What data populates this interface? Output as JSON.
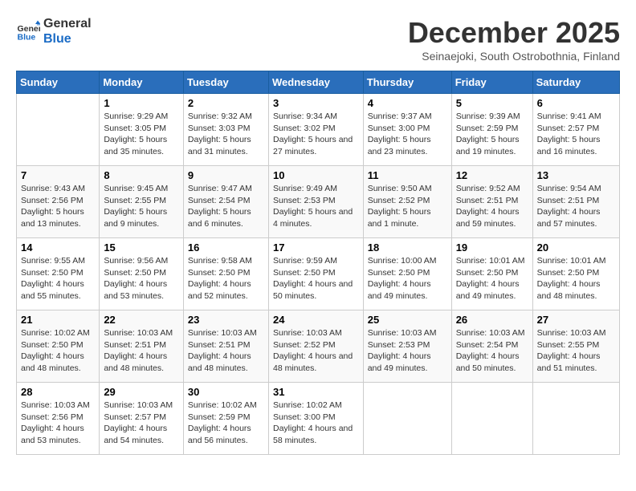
{
  "header": {
    "logo_line1": "General",
    "logo_line2": "Blue",
    "month": "December 2025",
    "location": "Seinaejoki, South Ostrobothnia, Finland"
  },
  "days_of_week": [
    "Sunday",
    "Monday",
    "Tuesday",
    "Wednesday",
    "Thursday",
    "Friday",
    "Saturday"
  ],
  "weeks": [
    [
      {
        "day": "",
        "sunrise": "",
        "sunset": "",
        "daylight": ""
      },
      {
        "day": "1",
        "sunrise": "Sunrise: 9:29 AM",
        "sunset": "Sunset: 3:05 PM",
        "daylight": "Daylight: 5 hours and 35 minutes."
      },
      {
        "day": "2",
        "sunrise": "Sunrise: 9:32 AM",
        "sunset": "Sunset: 3:03 PM",
        "daylight": "Daylight: 5 hours and 31 minutes."
      },
      {
        "day": "3",
        "sunrise": "Sunrise: 9:34 AM",
        "sunset": "Sunset: 3:02 PM",
        "daylight": "Daylight: 5 hours and 27 minutes."
      },
      {
        "day": "4",
        "sunrise": "Sunrise: 9:37 AM",
        "sunset": "Sunset: 3:00 PM",
        "daylight": "Daylight: 5 hours and 23 minutes."
      },
      {
        "day": "5",
        "sunrise": "Sunrise: 9:39 AM",
        "sunset": "Sunset: 2:59 PM",
        "daylight": "Daylight: 5 hours and 19 minutes."
      },
      {
        "day": "6",
        "sunrise": "Sunrise: 9:41 AM",
        "sunset": "Sunset: 2:57 PM",
        "daylight": "Daylight: 5 hours and 16 minutes."
      }
    ],
    [
      {
        "day": "7",
        "sunrise": "Sunrise: 9:43 AM",
        "sunset": "Sunset: 2:56 PM",
        "daylight": "Daylight: 5 hours and 13 minutes."
      },
      {
        "day": "8",
        "sunrise": "Sunrise: 9:45 AM",
        "sunset": "Sunset: 2:55 PM",
        "daylight": "Daylight: 5 hours and 9 minutes."
      },
      {
        "day": "9",
        "sunrise": "Sunrise: 9:47 AM",
        "sunset": "Sunset: 2:54 PM",
        "daylight": "Daylight: 5 hours and 6 minutes."
      },
      {
        "day": "10",
        "sunrise": "Sunrise: 9:49 AM",
        "sunset": "Sunset: 2:53 PM",
        "daylight": "Daylight: 5 hours and 4 minutes."
      },
      {
        "day": "11",
        "sunrise": "Sunrise: 9:50 AM",
        "sunset": "Sunset: 2:52 PM",
        "daylight": "Daylight: 5 hours and 1 minute."
      },
      {
        "day": "12",
        "sunrise": "Sunrise: 9:52 AM",
        "sunset": "Sunset: 2:51 PM",
        "daylight": "Daylight: 4 hours and 59 minutes."
      },
      {
        "day": "13",
        "sunrise": "Sunrise: 9:54 AM",
        "sunset": "Sunset: 2:51 PM",
        "daylight": "Daylight: 4 hours and 57 minutes."
      }
    ],
    [
      {
        "day": "14",
        "sunrise": "Sunrise: 9:55 AM",
        "sunset": "Sunset: 2:50 PM",
        "daylight": "Daylight: 4 hours and 55 minutes."
      },
      {
        "day": "15",
        "sunrise": "Sunrise: 9:56 AM",
        "sunset": "Sunset: 2:50 PM",
        "daylight": "Daylight: 4 hours and 53 minutes."
      },
      {
        "day": "16",
        "sunrise": "Sunrise: 9:58 AM",
        "sunset": "Sunset: 2:50 PM",
        "daylight": "Daylight: 4 hours and 52 minutes."
      },
      {
        "day": "17",
        "sunrise": "Sunrise: 9:59 AM",
        "sunset": "Sunset: 2:50 PM",
        "daylight": "Daylight: 4 hours and 50 minutes."
      },
      {
        "day": "18",
        "sunrise": "Sunrise: 10:00 AM",
        "sunset": "Sunset: 2:50 PM",
        "daylight": "Daylight: 4 hours and 49 minutes."
      },
      {
        "day": "19",
        "sunrise": "Sunrise: 10:01 AM",
        "sunset": "Sunset: 2:50 PM",
        "daylight": "Daylight: 4 hours and 49 minutes."
      },
      {
        "day": "20",
        "sunrise": "Sunrise: 10:01 AM",
        "sunset": "Sunset: 2:50 PM",
        "daylight": "Daylight: 4 hours and 48 minutes."
      }
    ],
    [
      {
        "day": "21",
        "sunrise": "Sunrise: 10:02 AM",
        "sunset": "Sunset: 2:50 PM",
        "daylight": "Daylight: 4 hours and 48 minutes."
      },
      {
        "day": "22",
        "sunrise": "Sunrise: 10:03 AM",
        "sunset": "Sunset: 2:51 PM",
        "daylight": "Daylight: 4 hours and 48 minutes."
      },
      {
        "day": "23",
        "sunrise": "Sunrise: 10:03 AM",
        "sunset": "Sunset: 2:51 PM",
        "daylight": "Daylight: 4 hours and 48 minutes."
      },
      {
        "day": "24",
        "sunrise": "Sunrise: 10:03 AM",
        "sunset": "Sunset: 2:52 PM",
        "daylight": "Daylight: 4 hours and 48 minutes."
      },
      {
        "day": "25",
        "sunrise": "Sunrise: 10:03 AM",
        "sunset": "Sunset: 2:53 PM",
        "daylight": "Daylight: 4 hours and 49 minutes."
      },
      {
        "day": "26",
        "sunrise": "Sunrise: 10:03 AM",
        "sunset": "Sunset: 2:54 PM",
        "daylight": "Daylight: 4 hours and 50 minutes."
      },
      {
        "day": "27",
        "sunrise": "Sunrise: 10:03 AM",
        "sunset": "Sunset: 2:55 PM",
        "daylight": "Daylight: 4 hours and 51 minutes."
      }
    ],
    [
      {
        "day": "28",
        "sunrise": "Sunrise: 10:03 AM",
        "sunset": "Sunset: 2:56 PM",
        "daylight": "Daylight: 4 hours and 53 minutes."
      },
      {
        "day": "29",
        "sunrise": "Sunrise: 10:03 AM",
        "sunset": "Sunset: 2:57 PM",
        "daylight": "Daylight: 4 hours and 54 minutes."
      },
      {
        "day": "30",
        "sunrise": "Sunrise: 10:02 AM",
        "sunset": "Sunset: 2:59 PM",
        "daylight": "Daylight: 4 hours and 56 minutes."
      },
      {
        "day": "31",
        "sunrise": "Sunrise: 10:02 AM",
        "sunset": "Sunset: 3:00 PM",
        "daylight": "Daylight: 4 hours and 58 minutes."
      },
      {
        "day": "",
        "sunrise": "",
        "sunset": "",
        "daylight": ""
      },
      {
        "day": "",
        "sunrise": "",
        "sunset": "",
        "daylight": ""
      },
      {
        "day": "",
        "sunrise": "",
        "sunset": "",
        "daylight": ""
      }
    ]
  ]
}
